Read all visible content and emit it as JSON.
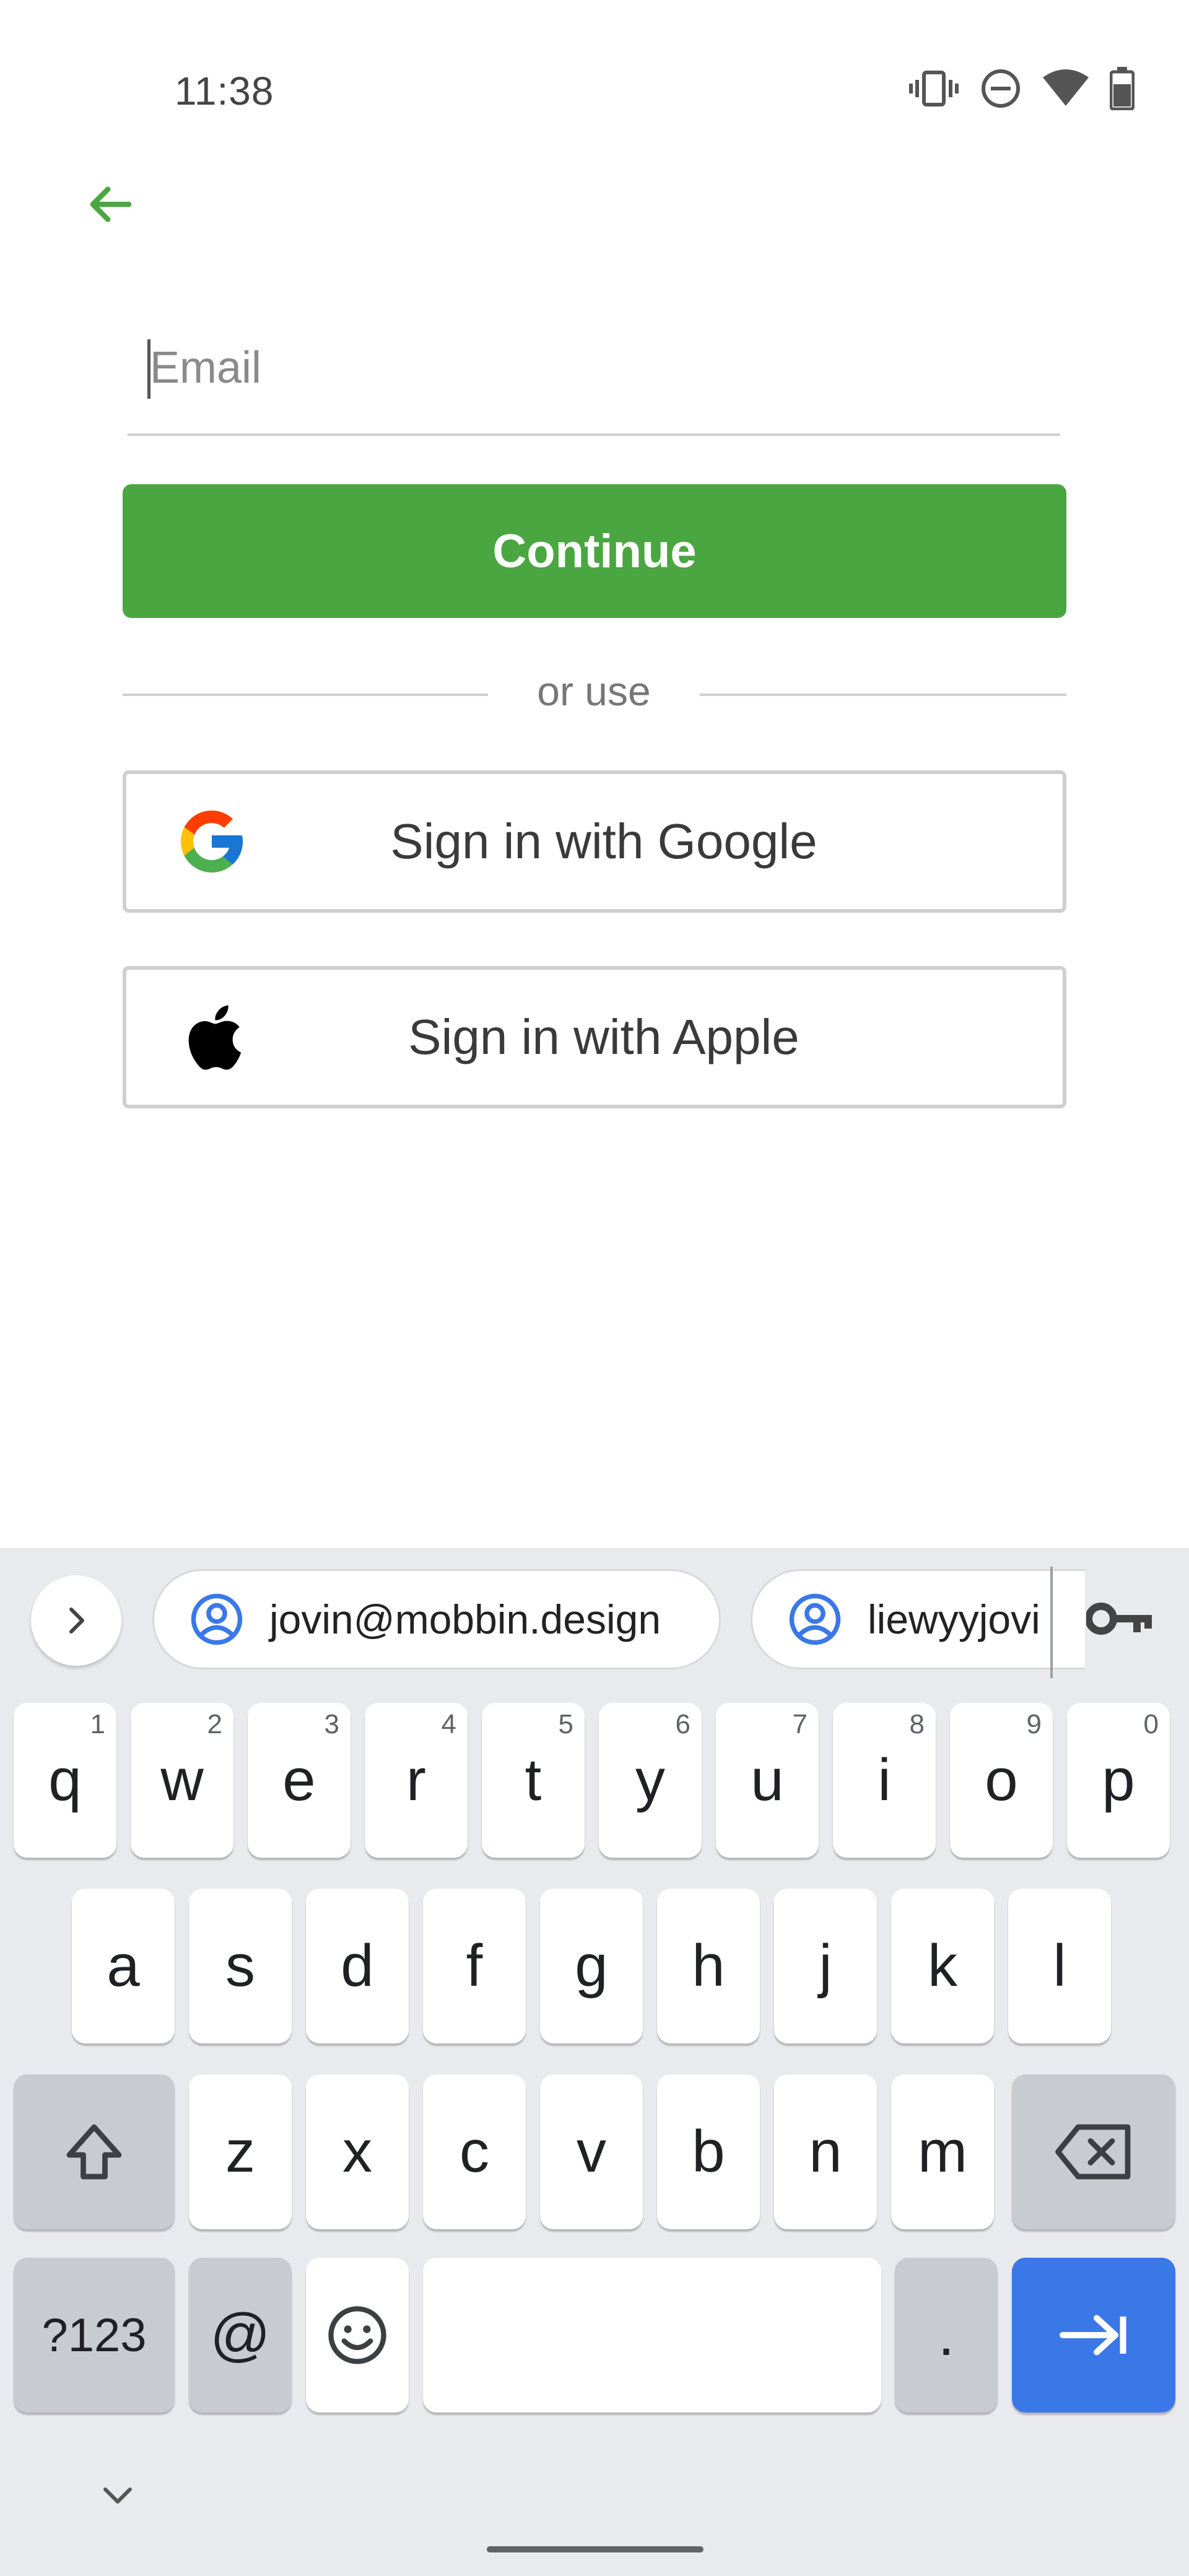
{
  "status_bar": {
    "time": "11:38",
    "icons": [
      "vibrate-icon",
      "do-not-disturb-icon",
      "wifi-icon",
      "battery-icon"
    ]
  },
  "header": {
    "back_icon": "arrow-left-icon"
  },
  "form": {
    "email": {
      "placeholder": "Email",
      "value": ""
    },
    "continue_label": "Continue",
    "divider_text": "or use",
    "google_label": "Sign in with Google",
    "apple_label": "Sign in with Apple"
  },
  "colors": {
    "accent": "#4aa641",
    "keyboard_bg": "#e8eaed",
    "keyboard_action": "#3b78e7"
  },
  "keyboard": {
    "suggestions": [
      {
        "text": "jovin@mobbin.design",
        "icon": "account-circle-icon"
      },
      {
        "text": "liewyyjovi",
        "icon": "account-circle-icon"
      }
    ],
    "row1": [
      {
        "label": "q",
        "hint": "1"
      },
      {
        "label": "w",
        "hint": "2"
      },
      {
        "label": "e",
        "hint": "3"
      },
      {
        "label": "r",
        "hint": "4"
      },
      {
        "label": "t",
        "hint": "5"
      },
      {
        "label": "y",
        "hint": "6"
      },
      {
        "label": "u",
        "hint": "7"
      },
      {
        "label": "i",
        "hint": "8"
      },
      {
        "label": "o",
        "hint": "9"
      },
      {
        "label": "p",
        "hint": "0"
      }
    ],
    "row2": [
      "a",
      "s",
      "d",
      "f",
      "g",
      "h",
      "j",
      "k",
      "l"
    ],
    "row3": [
      "z",
      "x",
      "c",
      "v",
      "b",
      "n",
      "m"
    ],
    "row4": {
      "symbols": "?123",
      "at": "@",
      "period": "."
    }
  }
}
